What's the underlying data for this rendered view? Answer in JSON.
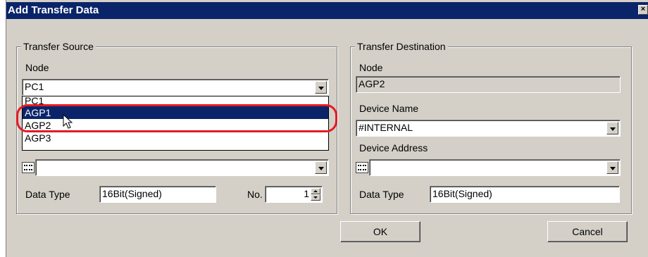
{
  "window": {
    "title": "Add Transfer Data",
    "close_glyph": "×"
  },
  "source": {
    "group_title": "Transfer Source",
    "node_label": "Node",
    "node_value": "PC1",
    "dropdown_options": [
      "PC1",
      "AGP1",
      "AGP2",
      "AGP3"
    ],
    "selected_option": "AGP1",
    "device_address_value": "",
    "data_type_label": "Data Type",
    "data_type_value": "16Bit(Signed)",
    "no_label": "No.",
    "no_value": "1"
  },
  "destination": {
    "group_title": "Transfer Destination",
    "node_label": "Node",
    "node_value": "AGP2",
    "device_name_label": "Device Name",
    "device_name_value": "#INTERNAL",
    "device_address_label": "Device Address",
    "device_address_value": "",
    "data_type_label": "Data Type",
    "data_type_value": "16Bit(Signed)"
  },
  "buttons": {
    "ok": "OK",
    "cancel": "Cancel"
  },
  "colors": {
    "highlight": "#e31b23",
    "selection": "#0a246a",
    "face": "#d4d0c8"
  }
}
